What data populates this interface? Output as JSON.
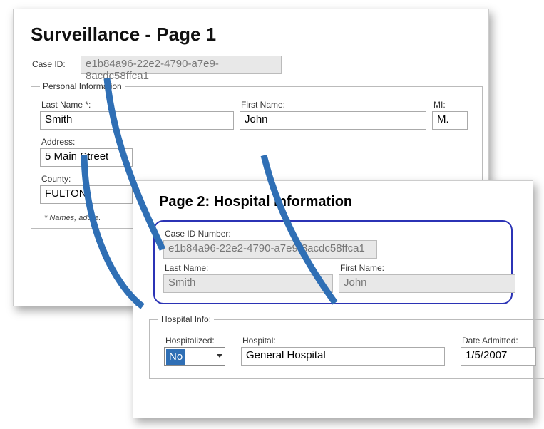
{
  "page1": {
    "title": "Surveillance - Page 1",
    "caseIdLabel": "Case ID:",
    "caseId": "e1b84a96-22e2-4790-a7e9-8acdc58ffca1",
    "personal": {
      "legend": "Personal Information",
      "lastNameLabel": "Last Name *:",
      "lastName": "Smith",
      "firstNameLabel": "First Name:",
      "firstName": "John",
      "miLabel": "MI:",
      "mi": "M.",
      "addressLabel": "Address:",
      "address": "5 Main Street",
      "countyLabel": "County:",
      "county": "FULTON",
      "note": "* Names, addre."
    }
  },
  "page2": {
    "title": "Page 2: Hospital Information",
    "caseIdLabel": "Case ID Number:",
    "caseId": "e1b84a96-22e2-4790-a7e9-8acdc58ffca1",
    "lastNameLabel": "Last Name:",
    "lastName": "Smith",
    "firstNameLabel": "First Name:",
    "firstName": "John",
    "hospital": {
      "legend": "Hospital Info:",
      "hospitalizedLabel": "Hospitalized:",
      "hospitalized": "No",
      "hospitalLabel": "Hospital:",
      "hospital": "General Hospital",
      "dateAdmittedLabel": "Date Admitted:",
      "dateAdmitted": "1/5/2007"
    }
  }
}
